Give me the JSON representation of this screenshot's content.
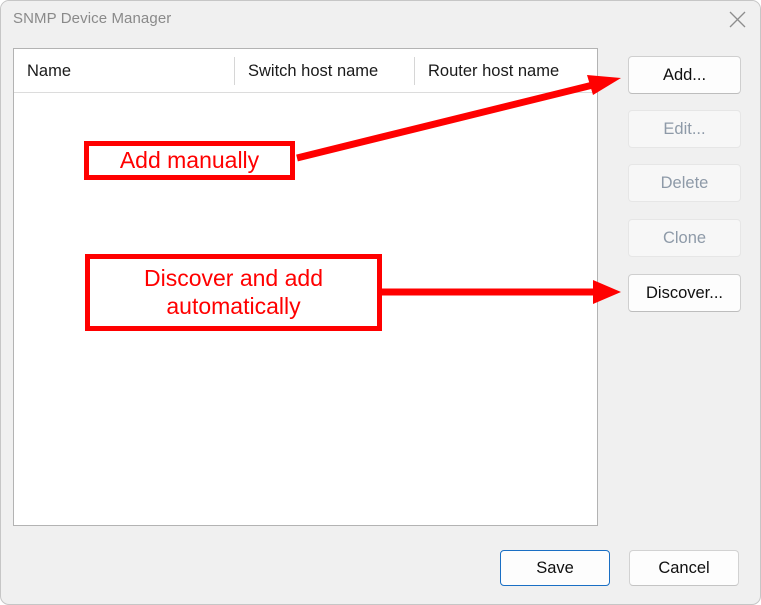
{
  "window": {
    "title": "SNMP Device Manager",
    "close_icon": "close-x-icon"
  },
  "device_list": {
    "columns": [
      {
        "label": "Name"
      },
      {
        "label": "Switch host name"
      },
      {
        "label": "Router host name"
      }
    ],
    "rows": [],
    "empty": true
  },
  "side_actions": [
    {
      "label": "Add...",
      "enabled": true
    },
    {
      "label": "Edit...",
      "enabled": false
    },
    {
      "label": "Delete",
      "enabled": false
    },
    {
      "label": "Clone",
      "enabled": false
    },
    {
      "label": "Discover...",
      "enabled": true
    }
  ],
  "footer": {
    "save_label": "Save",
    "cancel_label": "Cancel"
  },
  "annotations": {
    "color": "#ff0000",
    "callout_add": {
      "text": "Add manually",
      "points_to": "Add..."
    },
    "callout_discover": {
      "line1": "Discover and add",
      "line2": "automatically",
      "points_to": "Discover..."
    }
  }
}
